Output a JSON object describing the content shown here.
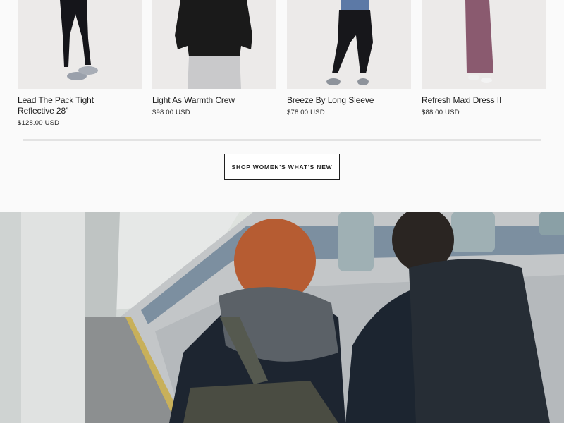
{
  "products": [
    {
      "name": "Lead The Pack Tight\nReflective 28”",
      "name_line1": "Lead The Pack Tight",
      "name_line2": "Reflective 28”",
      "price": "$128.00 USD"
    },
    {
      "name": "Light As Warmth Crew",
      "name_line1": "Light As Warmth Crew",
      "price": "$98.00 USD"
    },
    {
      "name": "Breeze By Long Sleeve",
      "name_line1": "Breeze By Long Sleeve",
      "price": "$78.00 USD"
    },
    {
      "name": "Refresh Maxi Dress II",
      "name_line1": "Refresh Maxi Dress II",
      "price": "$88.00 USD"
    }
  ],
  "cta": {
    "label": "SHOP WOMEN'S WHAT'S NEW"
  },
  "colors": {
    "background": "#fafafa",
    "product_bg": "#eceae9",
    "border": "#1f1f1f"
  }
}
